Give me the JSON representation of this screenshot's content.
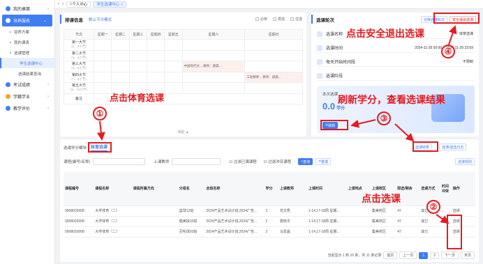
{
  "sidebar": {
    "items": [
      {
        "label": "我的桌面",
        "color": "#3f7df5"
      },
      {
        "label": "培养服务",
        "color": "#ffffff"
      }
    ],
    "subs": [
      "培养方案",
      "我的课表",
      "选课管理"
    ],
    "subsubs": [
      "学生选课中心",
      "选课结果查询"
    ],
    "bottom": [
      {
        "label": "考试成绩",
        "color": "#3f7df5"
      },
      {
        "label": "学籍学业",
        "color": "#f5a623"
      },
      {
        "label": "教学评价",
        "color": "#3f7df5"
      }
    ]
  },
  "topbar": {
    "home": "个人中心",
    "tab": "学生选课中心 ×"
  },
  "schedule": {
    "title": "排课信息",
    "mode": "默认节次模式",
    "legend": [
      "必修",
      "限选",
      "任选"
    ],
    "days": [
      "节次",
      "星期一",
      "星期二",
      "星期三",
      "星期四",
      "星期五",
      "星期六",
      "星期日"
    ],
    "periods": [
      {
        "name": "第一大节",
        "time": "(1、2小节)"
      },
      {
        "name": "第二大节",
        "time": "(3、4小节)"
      },
      {
        "name": "第三大节",
        "time": "(5、6小节)"
      },
      {
        "name": "第四大节",
        "time": "(7、8小节)"
      },
      {
        "name": "第五大节",
        "time": "(9、10小节)"
      },
      {
        "name": "备注",
        "time": ""
      }
    ],
    "course1": "中国现代文... 教师：颜晨...",
    "course2": "工程精神... 教师：颜晨...",
    "fold": "收起 ▲"
  },
  "select": {
    "title": "选课轮次",
    "switch_btn": "切换选课轮次",
    "exit_btn": "安全退出选课",
    "rows": [
      {
        "label": "选课名称",
        "value": "体育选课"
      },
      {
        "label": "选课时间",
        "value": "2024-11-26 00:00 ~ 2024-11-29 23:59"
      },
      {
        "label": "每天开始时间段",
        "value": "不限制"
      },
      {
        "label": "选课阶段",
        "value": ""
      }
    ],
    "credit_label": "本次选课",
    "credit_value": "0.0",
    "credit_unit": "学分",
    "refresh": "刷新"
  },
  "lower": {
    "sub_label": "选课学分模块",
    "tab": "体育选课",
    "result_btn": "选课结果",
    "exit_btn2": "选课/退选日志",
    "course_label": "课程(编号/名称)",
    "teacher_label": "上课教师",
    "chk1": "过滤已满课程",
    "chk2": "过滤冲突课程",
    "query": "查询",
    "reset": "重置",
    "notice": "选课规则",
    "headers": [
      "课程编号",
      "课程名称",
      "课程所属方向",
      "分组名",
      "合班名称",
      "学分",
      "上课教师",
      "上课时间",
      "上课地点",
      "上课校区",
      "限选/剩余",
      "选课方式",
      "时间冲突",
      "操作"
    ],
    "rows": [
      [
        "0008020008",
        "大学体育（二）",
        "",
        "篮球12班",
        "2024产品艺术设计班,2024广告...",
        "2",
        "苏文秀",
        "1-14,17-18周 星期...",
        "",
        "集美校区",
        "47",
        "其它",
        "",
        "选课"
      ],
      [
        "0008020008",
        "大学体育（二）",
        "",
        "健美操10班",
        "2024产品艺术设计班,2024广告...",
        "2",
        "唐晓华",
        "1-14,17-18周 星期...",
        "",
        "集美校区",
        "47",
        "其它",
        "",
        "选课"
      ],
      [
        "0008020008",
        "大学体育（二）",
        "",
        "羽毛球20班",
        "2024产品艺术设计班,2024广告...",
        "2",
        "马爱晶",
        "1-14,17-18周 星期...",
        "",
        "集美校区",
        "47",
        "其它",
        "",
        "选课"
      ]
    ],
    "pager": {
      "info": "当前显示 1 到 10 条，共 11 条记录",
      "first": "首页",
      "prev": "上一页",
      "p1": "1",
      "p2": "2",
      "next": "下一页",
      "last": "末页"
    }
  },
  "annotations": {
    "a1": "点击体育选课",
    "a2": "点击选课",
    "a3": "刷新学分，查看选课结果",
    "a4": "点击安全退出选课",
    "n1": "①",
    "n2": "②",
    "n3": "③",
    "n4": "④"
  },
  "colors": {
    "accent": "#3f7df5",
    "annotation": "#e8191f",
    "course": "#e0623b"
  }
}
